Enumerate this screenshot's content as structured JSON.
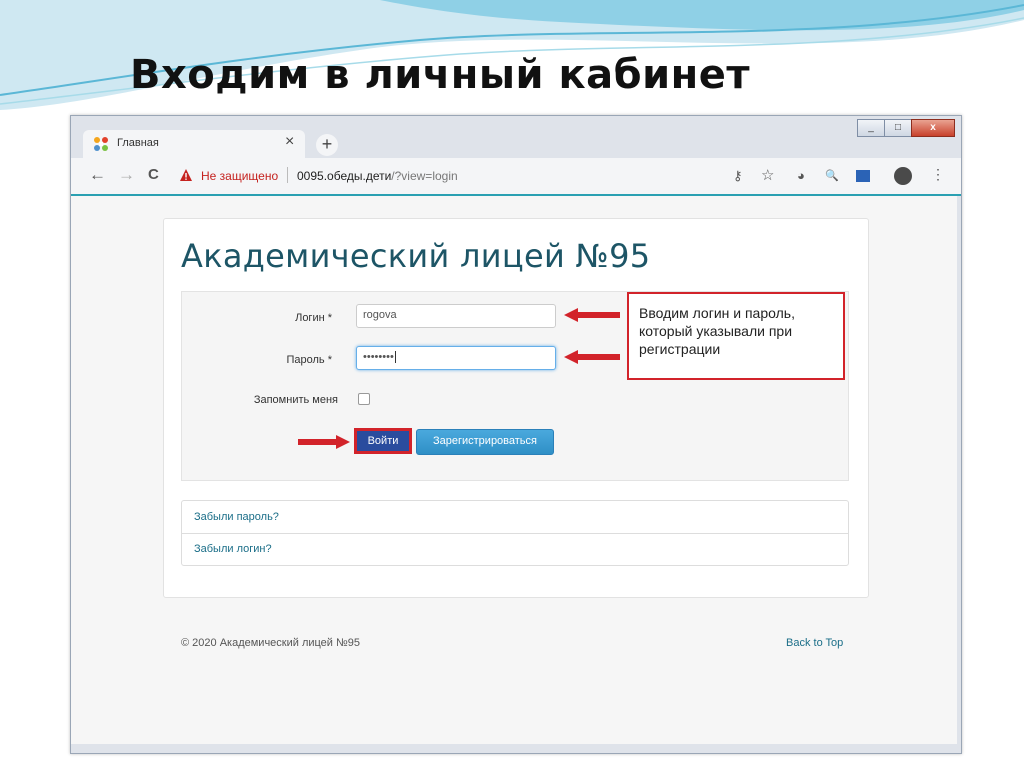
{
  "slide": {
    "title": "Входим в личный кабинет"
  },
  "browser": {
    "tab_title": "Главная",
    "tab_close": "×",
    "new_tab": "+",
    "win_min": "_",
    "win_max": "□",
    "win_close": "x",
    "back": "←",
    "forward": "→",
    "reload": "C",
    "security_label": "Не защищено",
    "url_host": "0095.обеды.дети",
    "url_path": "/?view=login"
  },
  "page": {
    "site_title": "Академический лицей №95",
    "form": {
      "login_label": "Логин *",
      "login_value": "rogova",
      "password_label": "Пароль *",
      "password_value": "••••••••",
      "remember_label": "Запомнить меня",
      "login_button": "Войти",
      "register_button": "Зарегистрироваться"
    },
    "callout": "Вводим логин и пароль, который указывали при регистрации",
    "links": {
      "forgot_password": "Забыли пароль?",
      "forgot_login": "Забыли логин?"
    },
    "footer": {
      "copyright": "© 2020 Академический лицей №95",
      "back_to_top": "Back to Top"
    }
  },
  "colors": {
    "accent": "#1d5566",
    "link": "#1b6e88",
    "annotation": "#d2232a",
    "login_button": "#2a4c9e",
    "register_button": "#3a9bd1"
  }
}
